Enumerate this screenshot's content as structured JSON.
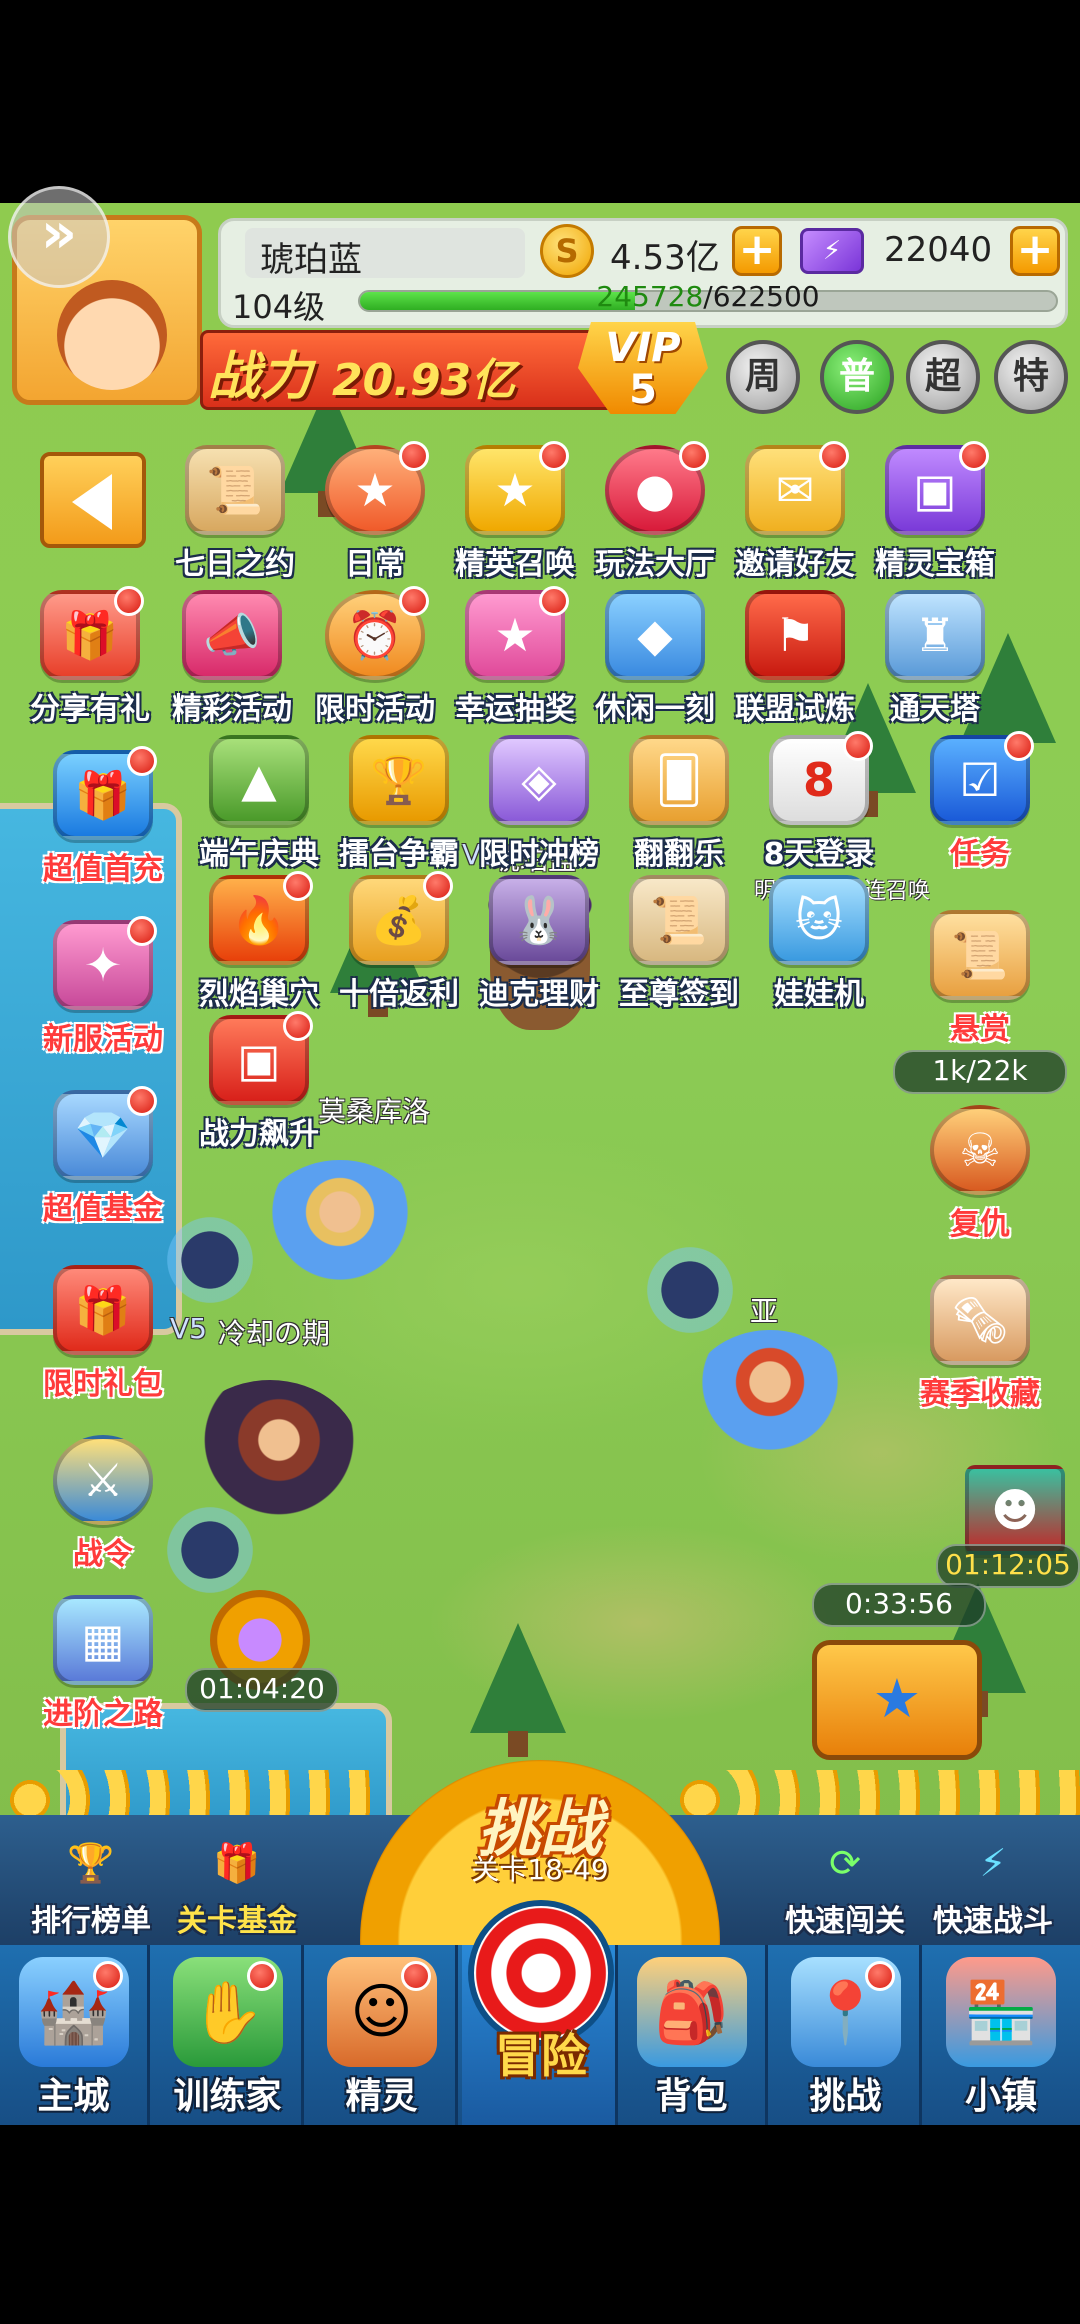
{
  "player": {
    "name": "琥珀蓝",
    "level": "104级",
    "gold": "4.53亿",
    "gems": "22040",
    "xp_current": "245728",
    "xp_max": "/622500",
    "xp_fraction": 0.395,
    "power_label": "战力",
    "power_value": "20.93亿",
    "vip_label": "VIP",
    "vip_level": "5"
  },
  "card_buttons": [
    "周",
    "普",
    "超",
    "特"
  ],
  "gold_icon_glyph": "S",
  "activities_row1": [
    "七日之约",
    "日常",
    "精英召唤",
    "玩法大厅",
    "邀请好友",
    "精灵宝箱"
  ],
  "activities_row2": [
    "分享有礼",
    "精彩活动",
    "限时活动",
    "幸运抽奖",
    "休闲一刻",
    "联盟试炼",
    "通天塔"
  ],
  "activities_row3": [
    "端午庆典",
    "擂台争霸",
    "限时冲榜",
    "翻翻乐",
    "8天登录"
  ],
  "login_sub": "明日领取十连召唤",
  "activities_row4": [
    "烈焰巢穴",
    "十倍返利",
    "迪克理财",
    "至尊签到",
    "娃娃机"
  ],
  "left_column": [
    "超值首充",
    "新服活动",
    "战力飙升",
    "超值基金",
    "限时礼包",
    "战令",
    "进阶之路"
  ],
  "right_column": [
    "任务",
    "悬赏",
    "复仇",
    "赛季收藏"
  ],
  "bounty_progress": "1k/22k",
  "world_labels": {
    "rank_player": "琥珀蓝",
    "player2": "莫桑库洛",
    "player3": "冷却の期",
    "player4": "亚",
    "v5a": "V5",
    "v5b": "V5"
  },
  "timers": {
    "right_top": "01:12:05",
    "chest": "0:33:56",
    "left_bottom": "01:04:20"
  },
  "quick_buttons": {
    "rank": "排行榜单",
    "stage_fund": "关卡基金",
    "quick_pass": "快速闯关",
    "quick_battle": "快速战斗"
  },
  "challenge": {
    "title": "挑战",
    "stage": "关卡18-49"
  },
  "nav": [
    "主城",
    "训练家",
    "精灵",
    "冒险",
    "背包",
    "挑战",
    "小镇"
  ],
  "colors": {
    "grass": "#8ccc55",
    "nav_blue": "#1f6fb0",
    "badge_red": "#d81a10",
    "gold": "#f0a400",
    "xp_green": "#2fae22"
  }
}
